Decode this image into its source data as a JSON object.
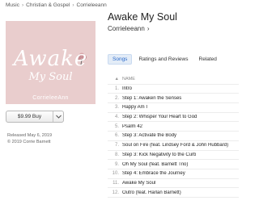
{
  "breadcrumb": [
    "Music",
    "Christian & Gospel",
    "Corrieleeann"
  ],
  "album": {
    "title": "Awake My Soul",
    "artist": "Corrieleeann",
    "cover_title": "Awake",
    "cover_subtitle": "My Soul",
    "cover_artist": "CorrieleeAnn",
    "price": "$9.99 Buy",
    "released": "Released May 6, 2019",
    "copyright": "© 2019 Corrie Barnett"
  },
  "tabs": [
    {
      "label": "Songs",
      "active": true
    },
    {
      "label": "Ratings and Reviews",
      "active": false
    },
    {
      "label": "Related",
      "active": false
    }
  ],
  "tracks_header": {
    "num": "▲",
    "name": "NAME"
  },
  "tracks": [
    {
      "num": "1.",
      "name": "Intro"
    },
    {
      "num": "2.",
      "name": "Step 1: Awaken the Senses"
    },
    {
      "num": "3.",
      "name": "Happy Am I"
    },
    {
      "num": "4.",
      "name": "Step 2: Whisper Your Heart to God"
    },
    {
      "num": "5.",
      "name": "Psalm 42"
    },
    {
      "num": "6.",
      "name": "Step 3: Activate the Body"
    },
    {
      "num": "7.",
      "name": "Soul on Fire (feat. Lindsey Ford & John Hubbard)"
    },
    {
      "num": "8.",
      "name": "Step 3: Kick Negativity to the Curb"
    },
    {
      "num": "9.",
      "name": "Oh My Soul (feat. Barnett Trio)"
    },
    {
      "num": "10.",
      "name": "Step 4: Embrace the Journey"
    },
    {
      "num": "11.",
      "name": "Awake My Soul"
    },
    {
      "num": "12.",
      "name": "Outro (feat. Harlan Barnett)"
    }
  ]
}
